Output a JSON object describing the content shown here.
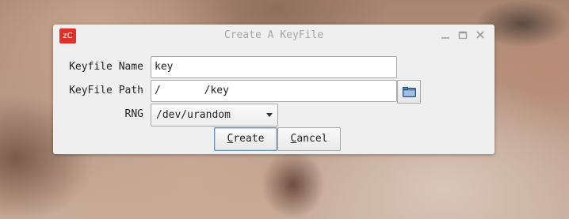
{
  "window": {
    "title": "Create A KeyFile",
    "app_icon_text": "zC"
  },
  "form": {
    "name_label": "Keyfile Name",
    "name_value": "key",
    "path_label": "KeyFile Path",
    "path_value": "/       /key",
    "rng_label": "RNG",
    "rng_selected": "/dev/urandom"
  },
  "buttons": {
    "create_mnemonic": "C",
    "create_rest": "reate",
    "cancel_mnemonic": "C",
    "cancel_rest": "ancel"
  },
  "icons": {
    "minimize": "minimize-icon",
    "maximize": "maximize-icon",
    "close": "close-icon",
    "folder": "folder-icon",
    "dropdown": "chevron-down-icon"
  },
  "colors": {
    "app_icon_bg": "#e0302a",
    "default_button_border": "#6a93b8",
    "dialog_bg": "#efefef"
  }
}
